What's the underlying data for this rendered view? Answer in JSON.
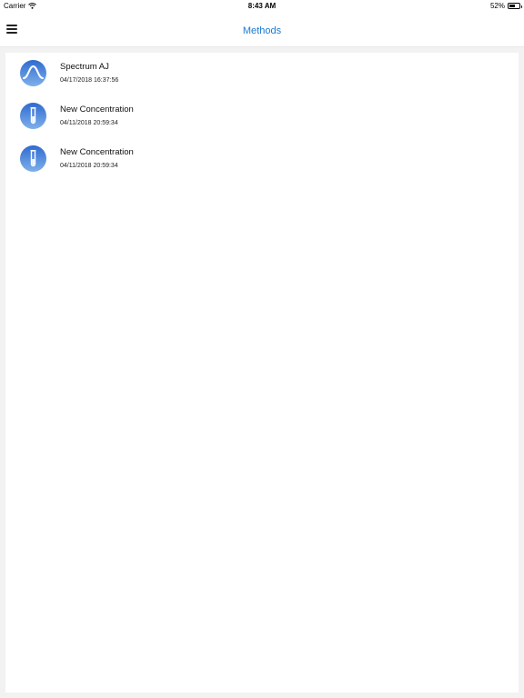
{
  "status_bar": {
    "carrier": "Carrier",
    "time": "8:43 AM",
    "battery": "52%",
    "battery_level": 0.52
  },
  "nav": {
    "title": "Methods",
    "menu_icon": "hamburger-menu-icon"
  },
  "colors": {
    "accent": "#1a7ad1",
    "icon_gradient_top": "#2f6bd0",
    "icon_gradient_bottom": "#7fb0ea"
  },
  "methods": [
    {
      "name": "Spectrum AJ",
      "date": "04/17/2018 16:37:56",
      "icon": "spectrum-wave-icon"
    },
    {
      "name": "New Concentration",
      "date": "04/11/2018 20:59:34",
      "icon": "test-tube-icon"
    },
    {
      "name": "New Concentration",
      "date": "04/11/2018 20:59:34",
      "icon": "test-tube-icon"
    }
  ]
}
